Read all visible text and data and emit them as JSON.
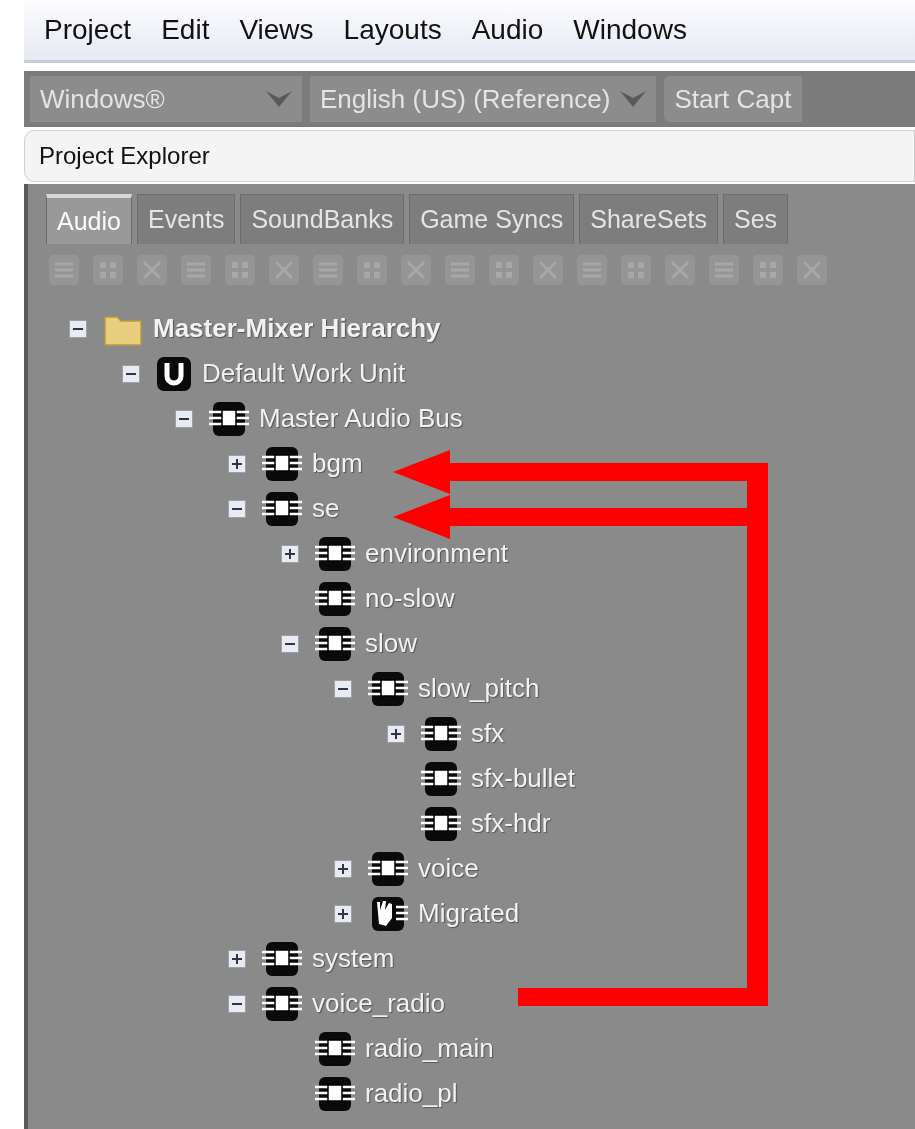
{
  "menu": [
    "Project",
    "Edit",
    "Views",
    "Layouts",
    "Audio",
    "Windows"
  ],
  "toolbar_dropdowns": [
    {
      "label": "Windows®",
      "kind": "dropdown"
    },
    {
      "label": "English (US) (Reference)",
      "kind": "dropdown"
    },
    {
      "label": "Start Capt",
      "kind": "button"
    }
  ],
  "panel": {
    "title": "Project Explorer"
  },
  "tabs": [
    {
      "label": "Audio",
      "selected": true
    },
    {
      "label": "Events",
      "selected": false
    },
    {
      "label": "SoundBanks",
      "selected": false
    },
    {
      "label": "Game Syncs",
      "selected": false
    },
    {
      "label": "ShareSets",
      "selected": false
    },
    {
      "label": "Ses",
      "selected": false
    }
  ],
  "tree": [
    {
      "label": "Master-Mixer Hierarchy",
      "kind": "folder",
      "expanded": true,
      "children": [
        {
          "label": "Default Work Unit",
          "kind": "work-unit",
          "expanded": true,
          "children": [
            {
              "label": "Master Audio Bus",
              "kind": "bus",
              "expanded": true,
              "children": [
                {
                  "label": "bgm",
                  "kind": "bus",
                  "expanded": false
                },
                {
                  "label": "se",
                  "kind": "bus",
                  "expanded": true,
                  "children": [
                    {
                      "label": "environment",
                      "kind": "bus",
                      "expanded": false
                    },
                    {
                      "label": "no-slow",
                      "kind": "bus"
                    },
                    {
                      "label": "slow",
                      "kind": "bus",
                      "expanded": true,
                      "children": [
                        {
                          "label": "slow_pitch",
                          "kind": "bus",
                          "expanded": true,
                          "children": [
                            {
                              "label": "sfx",
                              "kind": "bus",
                              "expanded": false
                            },
                            {
                              "label": "sfx-bullet",
                              "kind": "bus"
                            },
                            {
                              "label": "sfx-hdr",
                              "kind": "bus"
                            }
                          ]
                        },
                        {
                          "label": "voice",
                          "kind": "bus",
                          "expanded": false
                        },
                        {
                          "label": "Migrated",
                          "kind": "migrated",
                          "expanded": false
                        }
                      ]
                    }
                  ]
                },
                {
                  "label": "system",
                  "kind": "bus",
                  "expanded": false
                },
                {
                  "label": "voice_radio",
                  "kind": "bus",
                  "expanded": true,
                  "children": [
                    {
                      "label": "radio_main",
                      "kind": "bus"
                    },
                    {
                      "label": "radio_pl",
                      "kind": "bus"
                    }
                  ]
                }
              ]
            }
          ]
        }
      ]
    }
  ]
}
